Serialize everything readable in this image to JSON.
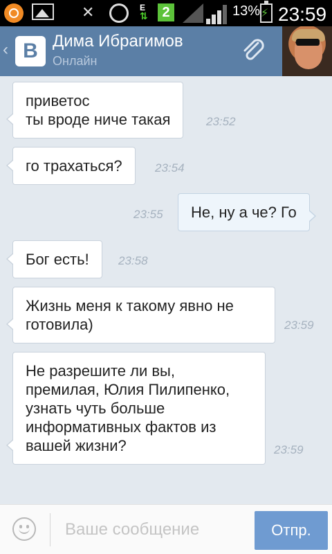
{
  "status_bar": {
    "battery_percent": "13%",
    "time": "23:59",
    "data_indicator": "E",
    "sim_slot": "2"
  },
  "header": {
    "logo_letter": "В",
    "contact_name": "Дима Ибрагимов",
    "contact_status": "Онлайн"
  },
  "messages": [
    {
      "direction": "in",
      "lines": [
        "приветос",
        "ты вроде ниче такая"
      ],
      "time": "23:52"
    },
    {
      "direction": "in",
      "lines": [
        "го трахаться?"
      ],
      "time": "23:54"
    },
    {
      "direction": "out",
      "lines": [
        "Не, ну а че? Го"
      ],
      "time": "23:55"
    },
    {
      "direction": "in",
      "lines": [
        "Бог есть!"
      ],
      "time": "23:58"
    },
    {
      "direction": "in",
      "lines": [
        "Жизнь меня к такому явно не",
        "готовила)"
      ],
      "time": "23:59"
    },
    {
      "direction": "in",
      "lines": [
        "Не разрешите ли вы,",
        "премилая, Юлия Пилипенко,",
        "узнать чуть больше",
        "информативных фактов из",
        "вашей жизни?"
      ],
      "time": "23:59"
    }
  ],
  "composer": {
    "placeholder": "Ваше сообщение",
    "send_label": "Отпр."
  },
  "colors": {
    "header_bg": "#5b7fa6",
    "chat_bg": "#e3e9ef",
    "send_button": "#6f9bd1"
  }
}
